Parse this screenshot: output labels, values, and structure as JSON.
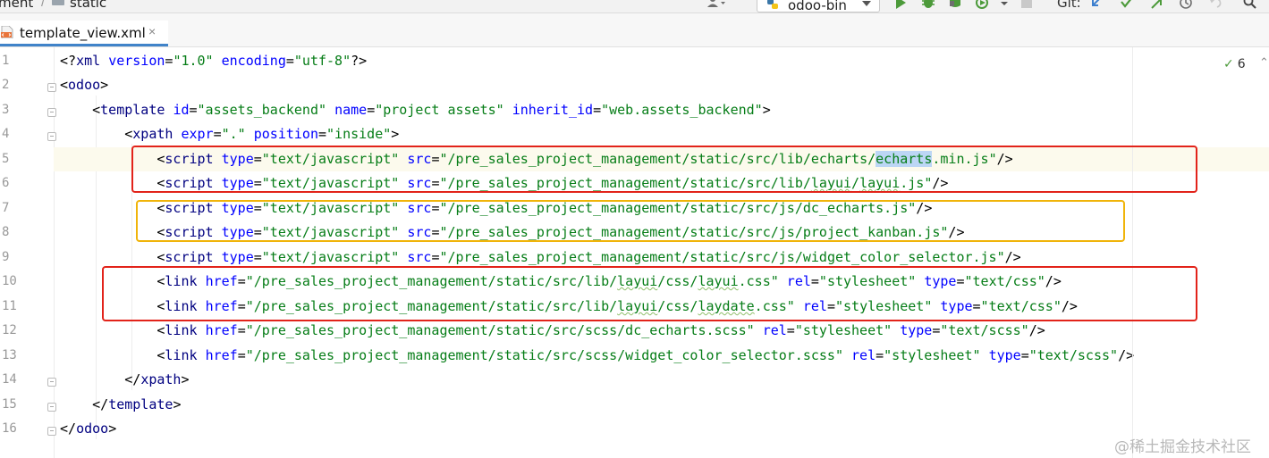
{
  "breadcrumbs": [
    "ment",
    "static"
  ],
  "toolbar": {
    "run_config": "odoo-bin",
    "git_label": "Git:",
    "buttons": [
      "run-icon",
      "debug-icon",
      "coverage-icon",
      "profile-icon",
      "more-dropdown-icon",
      "stop-icon",
      "git-update-icon",
      "git-commit-icon",
      "git-push-icon",
      "history-icon",
      "rollback-icon",
      "search-icon"
    ]
  },
  "tab": {
    "label": "template_view.xml",
    "close": "×",
    "icon": "xml-file-icon"
  },
  "editor": {
    "current_line": 5,
    "inspection": {
      "count": "6",
      "icon": "check-icon"
    },
    "lines": [
      {
        "n": "1",
        "text": "<?xml version=\"1.0\" encoding=\"utf-8\"?>"
      },
      {
        "n": "2",
        "text": "<odoo>"
      },
      {
        "n": "3",
        "text": "    <template id=\"assets_backend\" name=\"project assets\" inherit_id=\"web.assets_backend\">"
      },
      {
        "n": "4",
        "text": "        <xpath expr=\".\" position=\"inside\">"
      },
      {
        "n": "5",
        "text": "            <script type=\"text/javascript\" src=\"/pre_sales_project_management/static/src/lib/echarts/echarts.min.js\"/>"
      },
      {
        "n": "6",
        "text": "            <script type=\"text/javascript\" src=\"/pre_sales_project_management/static/src/lib/layui/layui.js\"/>"
      },
      {
        "n": "7",
        "text": "            <script type=\"text/javascript\" src=\"/pre_sales_project_management/static/src/js/dc_echarts.js\"/>"
      },
      {
        "n": "8",
        "text": "            <script type=\"text/javascript\" src=\"/pre_sales_project_management/static/src/js/project_kanban.js\"/>"
      },
      {
        "n": "9",
        "text": "            <script type=\"text/javascript\" src=\"/pre_sales_project_management/static/src/js/widget_color_selector.js\"/>"
      },
      {
        "n": "10",
        "text": "            <link href=\"/pre_sales_project_management/static/src/lib/layui/css/layui.css\" rel=\"stylesheet\" type=\"text/css\"/>"
      },
      {
        "n": "11",
        "text": "            <link href=\"/pre_sales_project_management/static/src/lib/layui/css/laydate.css\" rel=\"stylesheet\" type=\"text/css\"/>"
      },
      {
        "n": "12",
        "text": "            <link href=\"/pre_sales_project_management/static/src/scss/dc_echarts.scss\" rel=\"stylesheet\" type=\"text/scss\"/>"
      },
      {
        "n": "13",
        "text": "            <link href=\"/pre_sales_project_management/static/src/scss/widget_color_selector.scss\" rel=\"stylesheet\" type=\"text/scss\"/>"
      },
      {
        "n": "14",
        "text": "        </xpath>"
      },
      {
        "n": "15",
        "text": "    </template>"
      },
      {
        "n": "16",
        "text": "</odoo>"
      }
    ]
  },
  "highlight_boxes": [
    {
      "color": "red",
      "from_line": 5,
      "to_line": 6
    },
    {
      "color": "yellow",
      "from_line": 7,
      "to_line": 8
    },
    {
      "color": "red",
      "from_line": 10,
      "to_line": 11
    }
  ],
  "colors": {
    "tag": "#000080",
    "attribute": "#0000ff",
    "string": "#067d17",
    "box_red": "#e2231a",
    "box_yellow": "#f0b40a",
    "current_line": "#fcfaed",
    "selection": "#bcd6f5"
  },
  "watermark": "@稀土掘金技术社区"
}
